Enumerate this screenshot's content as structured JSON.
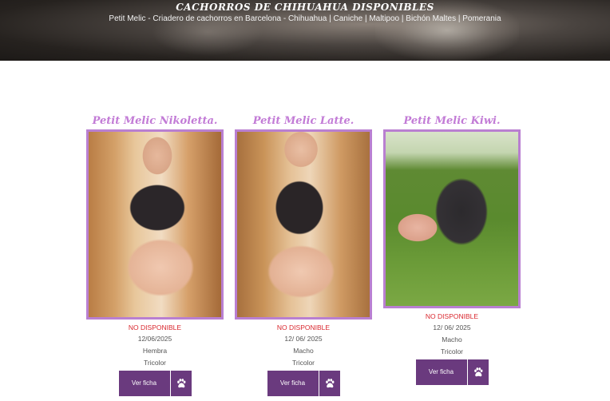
{
  "hero": {
    "title": "CACHORROS DE CHIHUAHUA DISPONIBLES",
    "subtitle": "Petit Melic - Criadero de cachorros en Barcelona - Chihuahua | Caniche | Maltipoo | Bichón Maltes | Pomerania"
  },
  "colors": {
    "accent_purple": "#6a3a7e",
    "name_pink": "#c27bd6",
    "frame_purple": "#b97fd1",
    "status_red": "#d9272e"
  },
  "puppies": [
    {
      "name": "Petit Melic Nikoletta.",
      "status": "NO DISPONIBLE",
      "date": "12/06/2025",
      "sex": "Hembra",
      "color": "Tricolor",
      "button_label": "Ver ficha",
      "icon": "paw-icon"
    },
    {
      "name": "Petit Melic Latte.",
      "status": "NO DISPONIBLE",
      "date": "12/ 06/ 2025",
      "sex": "Macho",
      "color": "Tricolor",
      "button_label": "Ver ficha",
      "icon": "paw-icon"
    },
    {
      "name": "Petit Melic Kiwi.",
      "status": "NO DISPONIBLE",
      "date": "12/ 06/ 2025",
      "sex": "Macho",
      "color": "Tricolor",
      "button_label": "Ver ficha",
      "icon": "paw-icon"
    }
  ]
}
